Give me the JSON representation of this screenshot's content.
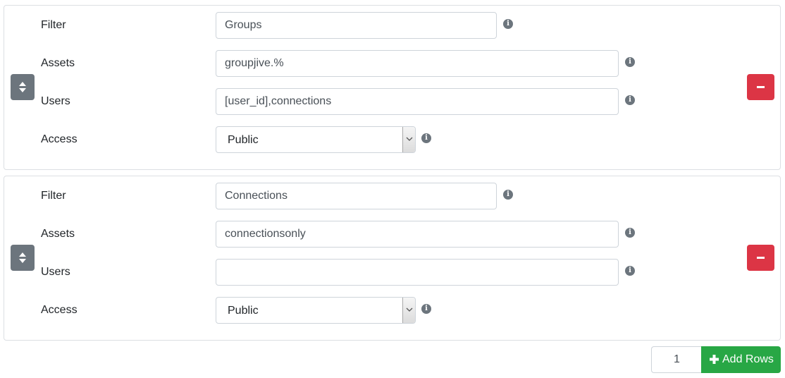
{
  "rows": [
    {
      "filter_label": "Filter",
      "filter_value": "Groups",
      "assets_label": "Assets",
      "assets_value": "groupjive.%",
      "users_label": "Users",
      "users_value": "[user_id],connections",
      "access_label": "Access",
      "access_value": "Public"
    },
    {
      "filter_label": "Filter",
      "filter_value": "Connections",
      "assets_label": "Assets",
      "assets_value": "connectionsonly",
      "users_label": "Users",
      "users_value": "",
      "access_label": "Access",
      "access_value": "Public"
    }
  ],
  "info_glyph": "i",
  "footer": {
    "rows_count": "1",
    "add_rows_label": "Add Rows"
  },
  "icons": {
    "sort": "sort-icon",
    "remove": "minus-icon",
    "info": "info-circle-icon",
    "add": "plus-icon"
  },
  "colors": {
    "sort_button": "#6c757d",
    "remove_button": "#dc3545",
    "add_button": "#28a745",
    "info_icon": "#6c757d"
  }
}
